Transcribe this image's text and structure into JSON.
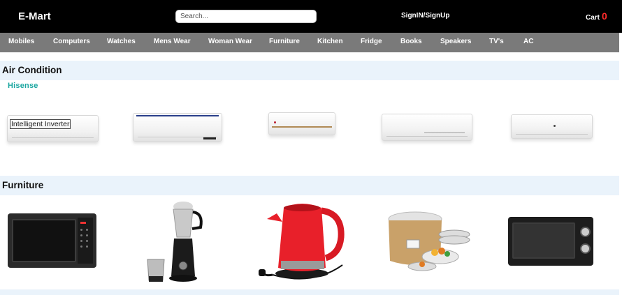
{
  "header": {
    "brand": "E-Mart",
    "search_placeholder": "Search...",
    "sign_label": "SignIN/SignUp",
    "cart_label": "Cart",
    "cart_count": "0"
  },
  "nav": {
    "items": [
      "Mobiles",
      "Computers",
      "Watches",
      "Mens Wear",
      "Woman Wear",
      "Furniture",
      "Kitchen",
      "Fridge",
      "Books",
      "Speakers",
      "TV's",
      "AC"
    ]
  },
  "sections": [
    {
      "title": "Air Condition",
      "brand": "Hisense",
      "products": [
        {
          "name": "ac-unit-1",
          "label": "Intelligent Inverter"
        },
        {
          "name": "ac-unit-2"
        },
        {
          "name": "ac-unit-3"
        },
        {
          "name": "ac-unit-4"
        },
        {
          "name": "ac-unit-5"
        }
      ]
    },
    {
      "title": "Furniture",
      "products": [
        {
          "name": "microwave"
        },
        {
          "name": "mixer-grinder"
        },
        {
          "name": "electric-kettle"
        },
        {
          "name": "rice-cooker"
        },
        {
          "name": "otg-oven"
        }
      ]
    }
  ],
  "colors": {
    "header_bg": "#000000",
    "nav_bg": "#7a7a7a",
    "section_bg": "#eaf3fb",
    "cart_count": "#ff2a2a",
    "brand_logo": "#1aa6a0",
    "kettle_red": "#e8202a"
  }
}
